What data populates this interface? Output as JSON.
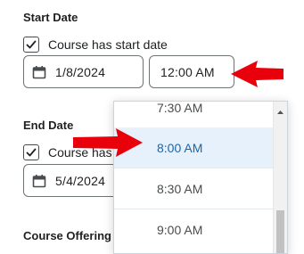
{
  "start_date": {
    "heading": "Start Date",
    "checkbox_label": "Course has start date",
    "date_value": "1/8/2024",
    "time_value": "12:00 AM"
  },
  "end_date": {
    "heading": "End Date",
    "checkbox_label": "Course has end date",
    "date_value": "5/4/2024"
  },
  "course_offering_heading": "Course Offering P",
  "time_dropdown": {
    "options": [
      "7:30 AM",
      "8:00 AM",
      "8:30 AM",
      "9:00 AM"
    ],
    "selected": "8:00 AM"
  },
  "colors": {
    "annotation_arrow": "#e8000b",
    "selected_option_bg": "#e6f1fb",
    "selected_option_text": "#1b64a8"
  }
}
